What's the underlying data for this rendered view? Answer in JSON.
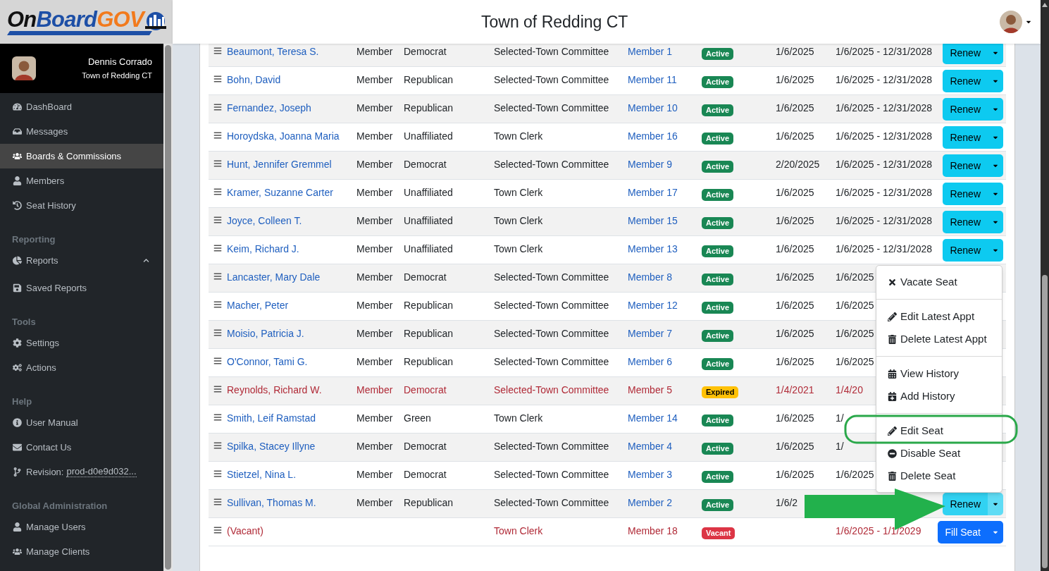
{
  "logo": [
    {
      "text": "On",
      "color": "#111111"
    },
    {
      "text": "Board",
      "color": "#1d4fa6"
    },
    {
      "text": "GOV",
      "color": "#f27a1c"
    }
  ],
  "user": {
    "name": "Dennis Corrado",
    "organization": "Town of Redding CT"
  },
  "header": {
    "title": "Town of Redding CT"
  },
  "sidebar": {
    "sections": [
      {
        "items": [
          {
            "label": "DashBoard",
            "selected": false
          },
          {
            "label": "Messages",
            "selected": false
          },
          {
            "label": "Boards & Commissions",
            "selected": true
          },
          {
            "label": "Members",
            "selected": false
          },
          {
            "label": "Seat History",
            "selected": false
          }
        ]
      },
      {
        "heading": "Reporting",
        "items": [
          {
            "label": "Reports",
            "selected": false,
            "expanded": true
          },
          {
            "label": "Saved Reports",
            "selected": false
          }
        ]
      },
      {
        "heading": "Tools",
        "items": [
          {
            "label": "Settings",
            "selected": false
          },
          {
            "label": "Actions",
            "selected": false
          }
        ]
      },
      {
        "heading": "Help",
        "items": [
          {
            "label": "User Manual",
            "selected": false
          },
          {
            "label": "Contact Us",
            "selected": false
          },
          {
            "label": "Revision:",
            "value": "prod-d0e9d032...",
            "selected": false
          }
        ]
      },
      {
        "heading": "Global Administration",
        "items": [
          {
            "label": "Manage Users",
            "selected": false
          },
          {
            "label": "Manage Clients",
            "selected": false
          }
        ]
      }
    ]
  },
  "table": {
    "rows": [
      {
        "name": "Beaumont, Teresa S.",
        "position": "Member",
        "party": "Democrat",
        "committee": "Selected-Town Committee",
        "seat": "Member 1",
        "status": {
          "label": "Active",
          "kind": "active"
        },
        "date": "1/6/2025",
        "term": "1/6/2025 - 12/31/2028",
        "button": {
          "label": "Renew",
          "kind": "renew",
          "open": false
        }
      },
      {
        "name": "Bohn, David",
        "position": "Member",
        "party": "Republican",
        "committee": "Selected-Town Committee",
        "seat": "Member 11",
        "status": {
          "label": "Active",
          "kind": "active"
        },
        "date": "1/6/2025",
        "term": "1/6/2025 - 12/31/2028",
        "button": {
          "label": "Renew",
          "kind": "renew",
          "open": false
        }
      },
      {
        "name": "Fernandez, Joseph",
        "position": "Member",
        "party": "Republican",
        "committee": "Selected-Town Committee",
        "seat": "Member 10",
        "status": {
          "label": "Active",
          "kind": "active"
        },
        "date": "1/6/2025",
        "term": "1/6/2025 - 12/31/2028",
        "button": {
          "label": "Renew",
          "kind": "renew",
          "open": false
        }
      },
      {
        "name": "Horoydska, Joanna Maria",
        "position": "Member",
        "party": "Unaffiliated",
        "committee": "Town Clerk",
        "seat": "Member 16",
        "status": {
          "label": "Active",
          "kind": "active"
        },
        "date": "1/6/2025",
        "term": "1/6/2025 - 12/31/2028",
        "button": {
          "label": "Renew",
          "kind": "renew",
          "open": false
        }
      },
      {
        "name": "Hunt, Jennifer Gremmel",
        "position": "Member",
        "party": "Democrat",
        "committee": "Selected-Town Committee",
        "seat": "Member 9",
        "status": {
          "label": "Active",
          "kind": "active"
        },
        "date": "2/20/2025",
        "term": "1/6/2025 - 12/31/2028",
        "button": {
          "label": "Renew",
          "kind": "renew",
          "open": false
        }
      },
      {
        "name": "Kramer, Suzanne Carter",
        "position": "Member",
        "party": "Unaffiliated",
        "committee": "Town Clerk",
        "seat": "Member 17",
        "status": {
          "label": "Active",
          "kind": "active"
        },
        "date": "1/6/2025",
        "term": "1/6/2025 - 12/31/2028",
        "button": {
          "label": "Renew",
          "kind": "renew",
          "open": false
        }
      },
      {
        "name": "Joyce, Colleen T.",
        "position": "Member",
        "party": "Unaffiliated",
        "committee": "Town Clerk",
        "seat": "Member 15",
        "status": {
          "label": "Active",
          "kind": "active"
        },
        "date": "1/6/2025",
        "term": "1/6/2025 - 12/31/2028",
        "button": {
          "label": "Renew",
          "kind": "renew",
          "open": false
        }
      },
      {
        "name": "Keim, Richard J.",
        "position": "Member",
        "party": "Unaffiliated",
        "committee": "Town Clerk",
        "seat": "Member 13",
        "status": {
          "label": "Active",
          "kind": "active"
        },
        "date": "1/6/2025",
        "term": "1/6/2025 - 12/31/2028",
        "button": {
          "label": "Renew",
          "kind": "renew",
          "open": false
        }
      },
      {
        "name": "Lancaster, Mary Dale",
        "position": "Member",
        "party": "Democrat",
        "committee": "Selected-Town Committee",
        "seat": "Member 8",
        "status": {
          "label": "Active",
          "kind": "active"
        },
        "date": "1/6/2025",
        "term": "1/6/2025"
      },
      {
        "name": "Macher, Peter",
        "position": "Member",
        "party": "Republican",
        "committee": "Selected-Town Committee",
        "seat": "Member 12",
        "status": {
          "label": "Active",
          "kind": "active"
        },
        "date": "1/6/2025",
        "term": "1/6/2025"
      },
      {
        "name": "Moisio, Patricia J.",
        "position": "Member",
        "party": "Republican",
        "committee": "Selected-Town Committee",
        "seat": "Member 7",
        "status": {
          "label": "Active",
          "kind": "active"
        },
        "date": "1/6/2025",
        "term": "1/6/2025"
      },
      {
        "name": "O'Connor, Tami G.",
        "position": "Member",
        "party": "Republican",
        "committee": "Selected-Town Committee",
        "seat": "Member 6",
        "status": {
          "label": "Active",
          "kind": "active"
        },
        "date": "1/6/2025",
        "term": "1/6/2025"
      },
      {
        "name": "Reynolds, Richard W.",
        "position": "Member",
        "party": "Democrat",
        "committee": "Selected-Town Committee",
        "seat": "Member 5",
        "status": {
          "label": "Expired",
          "kind": "expired"
        },
        "date": "1/4/2021",
        "term": "1/4/20"
      },
      {
        "name": "Smith, Leif Ramstad",
        "position": "Member",
        "party": "Green",
        "committee": "Town Clerk",
        "seat": "Member 14",
        "status": {
          "label": "Active",
          "kind": "active"
        },
        "date": "1/6/2025",
        "term": "1/"
      },
      {
        "name": "Spilka, Stacey Illyne",
        "position": "Member",
        "party": "Democrat",
        "committee": "Selected-Town Committee",
        "seat": "Member 4",
        "status": {
          "label": "Active",
          "kind": "active"
        },
        "date": "1/6/2025",
        "term": "1/"
      },
      {
        "name": "Stietzel, Nina L.",
        "position": "Member",
        "party": "Democrat",
        "committee": "Selected-Town Committee",
        "seat": "Member 3",
        "status": {
          "label": "Active",
          "kind": "active"
        },
        "date": "1/6/2025",
        "term": "1/6/2025"
      },
      {
        "name": "Sullivan, Thomas M.",
        "position": "Member",
        "party": "Republican",
        "committee": "Selected-Town Committee",
        "seat": "Member 2",
        "status": {
          "label": "Active",
          "kind": "active"
        },
        "date": "1/6/2",
        "button": {
          "label": "Renew",
          "kind": "renew",
          "open": true
        }
      },
      {
        "name": "(Vacant)",
        "committee": "Town Clerk",
        "seat": "Member 18",
        "status": {
          "label": "Vacant",
          "kind": "vacant"
        },
        "term": "1/6/2025 - 1/1/2029",
        "button": {
          "label": "Fill Seat",
          "kind": "fill",
          "open": false
        }
      }
    ]
  },
  "row_menu": {
    "groups": [
      [
        "Vacate Seat"
      ],
      [
        "Edit Latest Appt",
        "Delete Latest Appt"
      ],
      [
        "View History",
        "Add History"
      ],
      [
        "Edit Seat",
        "Disable Seat",
        "Delete Seat"
      ]
    ]
  }
}
